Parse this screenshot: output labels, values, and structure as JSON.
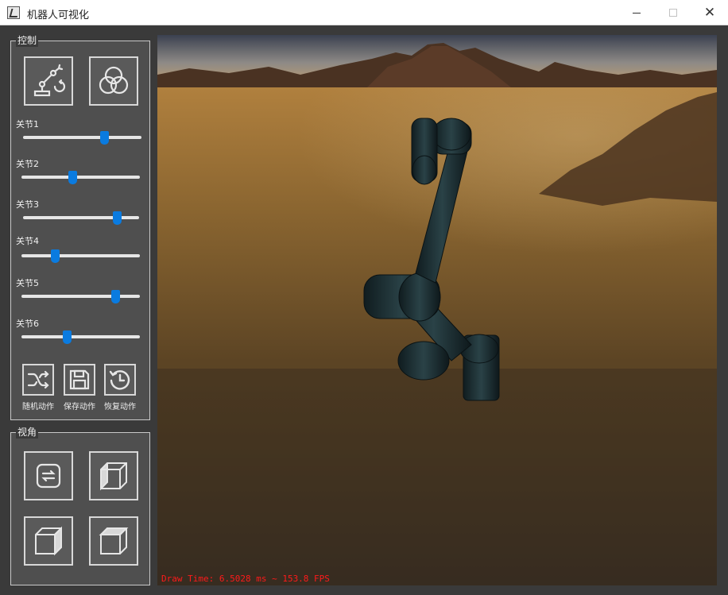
{
  "window": {
    "title": "机器人可视化",
    "close_glyph": "✕"
  },
  "control": {
    "title": "控制",
    "top_buttons": [
      {
        "icon": "robot-arm-icon"
      },
      {
        "icon": "color-circles-icon"
      }
    ],
    "joints": [
      {
        "label": "关节1",
        "value": 0.7
      },
      {
        "label": "关节2",
        "value": 0.43
      },
      {
        "label": "关节3",
        "value": 0.84
      },
      {
        "label": "关节4",
        "value": 0.27
      },
      {
        "label": "关节5",
        "value": 0.82
      },
      {
        "label": "关节6",
        "value": 0.38
      }
    ],
    "actions": [
      {
        "label": "随机动作",
        "icon": "shuffle-icon"
      },
      {
        "label": "保存动作",
        "icon": "save-icon"
      },
      {
        "label": "恢复动作",
        "icon": "restore-icon"
      }
    ]
  },
  "view": {
    "title": "视角",
    "buttons": [
      {
        "icon": "rotate-view-icon"
      },
      {
        "icon": "cube-view-1-icon"
      },
      {
        "icon": "cube-view-2-icon"
      },
      {
        "icon": "cube-view-3-icon"
      }
    ]
  },
  "viewport": {
    "status_text": "Draw Time: 6.5028 ms ~ 153.8 FPS",
    "status_color": "#ff1a1a",
    "robot_color": "#1f3236"
  }
}
